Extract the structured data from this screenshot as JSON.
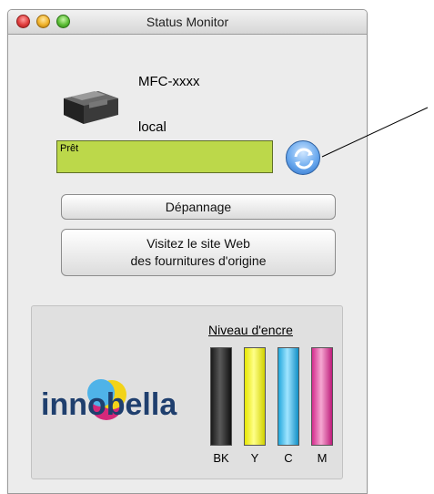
{
  "window": {
    "title": "Status Monitor"
  },
  "device": {
    "model": "MFC-xxxx",
    "location": "local"
  },
  "status": {
    "text": "Prêt",
    "color": "#bcd84a"
  },
  "buttons": {
    "troubleshoot": "Dépannage",
    "supplies_line1": "Visitez le site Web",
    "supplies_line2": "des fournitures d'origine"
  },
  "ink": {
    "title": "Niveau d'encre",
    "colors": [
      {
        "label": "BK",
        "name": "black",
        "level": 1.0
      },
      {
        "label": "Y",
        "name": "yellow",
        "level": 1.0
      },
      {
        "label": "C",
        "name": "cyan",
        "level": 1.0
      },
      {
        "label": "M",
        "name": "magenta",
        "level": 1.0
      }
    ]
  },
  "logo": {
    "text": "innobella"
  }
}
